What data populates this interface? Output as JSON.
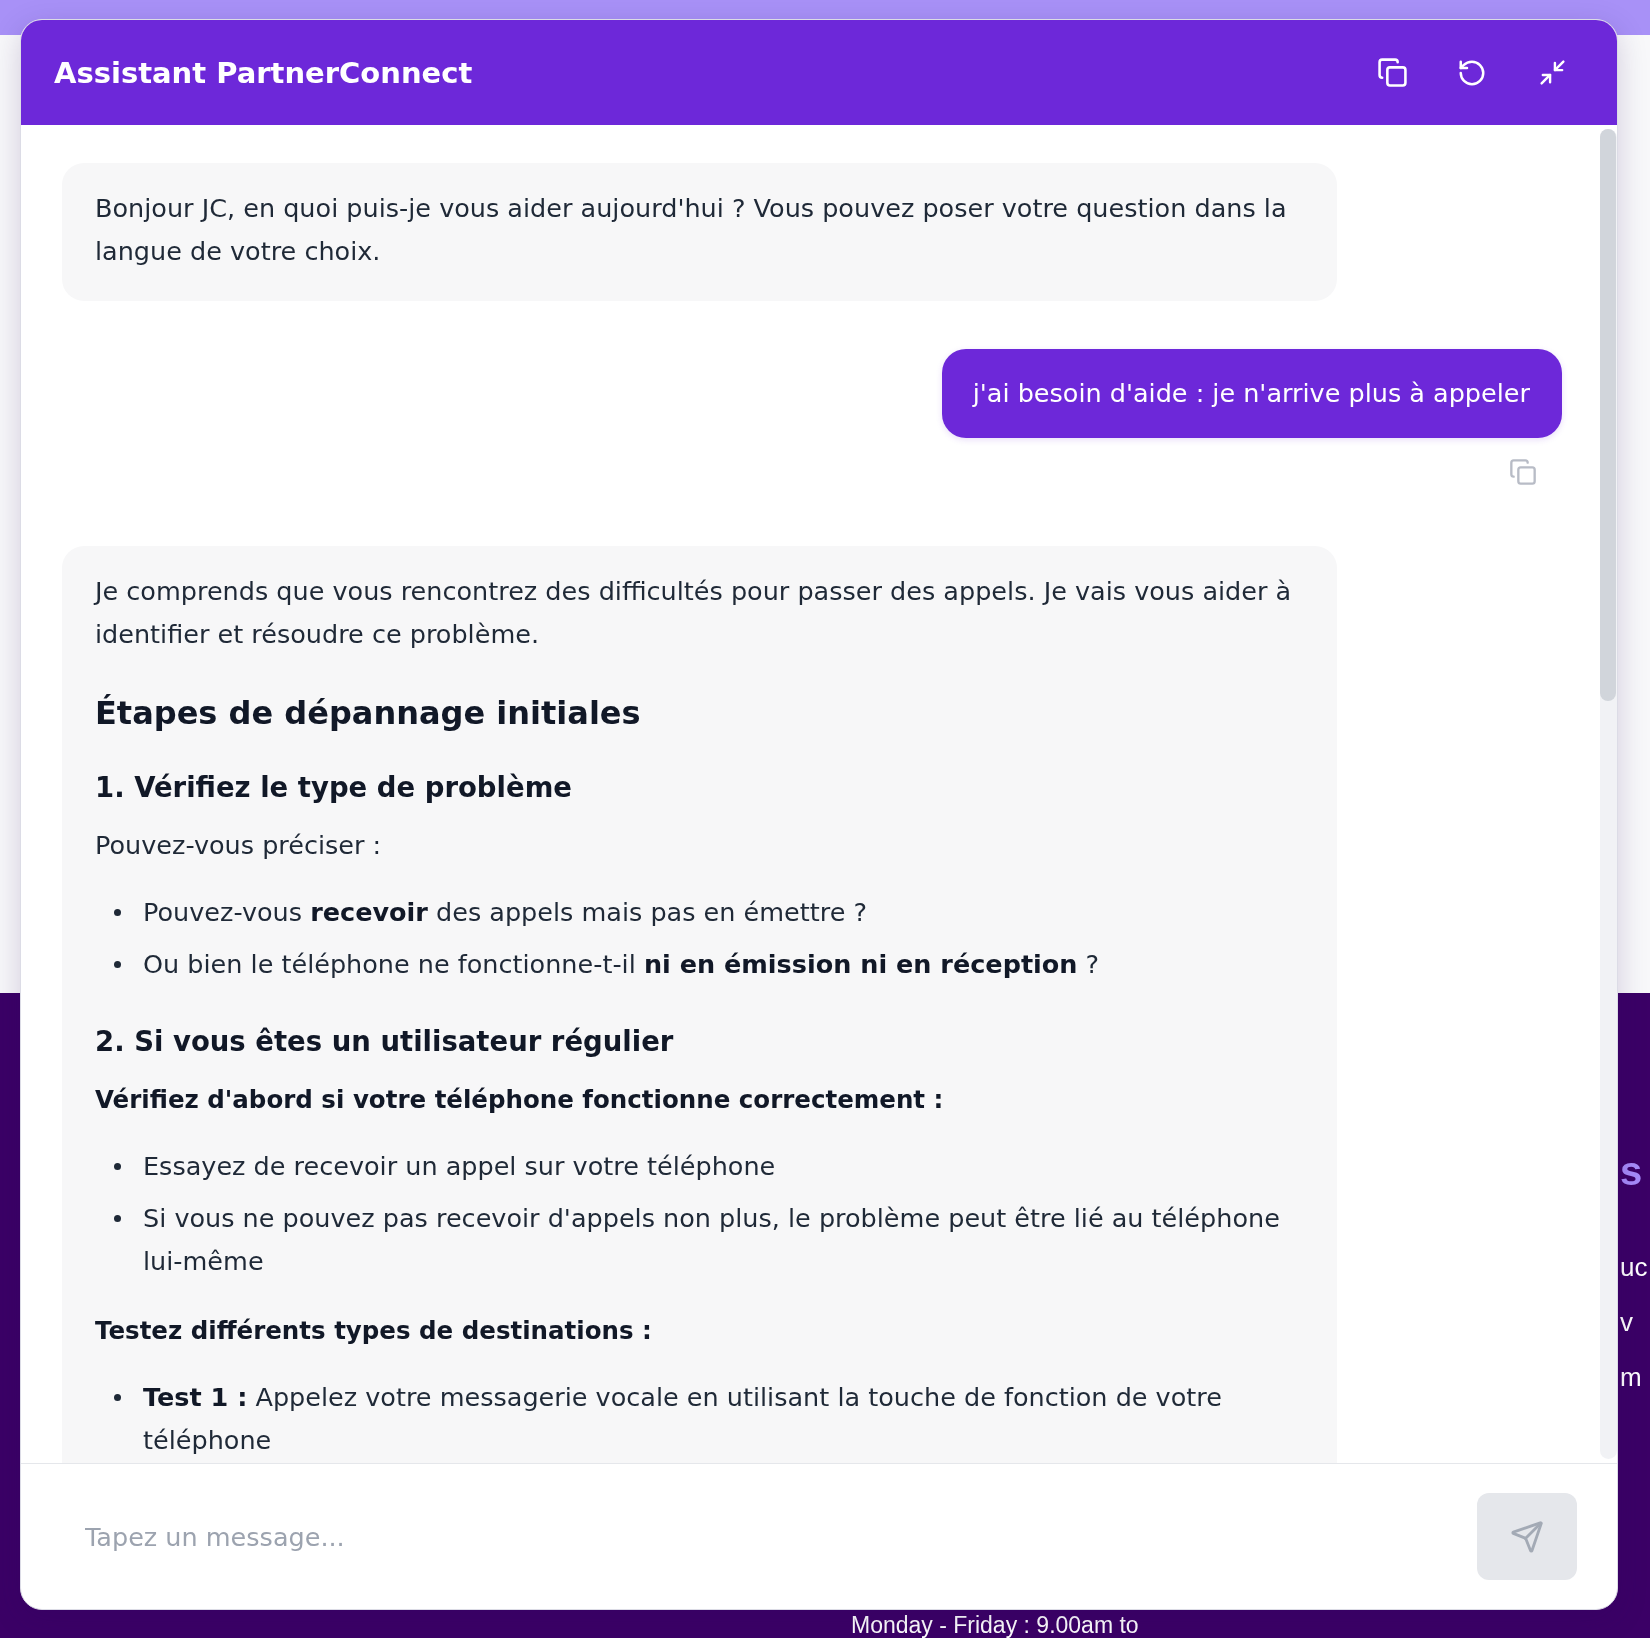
{
  "chat": {
    "title": "Assistant PartnerConnect",
    "messages": [
      {
        "kind": "assistant",
        "blocks": [
          {
            "kind": "paragraph",
            "text": "Bonjour JC, en quoi puis-je vous aider aujourd'hui ? Vous pouvez poser votre question dans la langue de votre choix."
          }
        ]
      },
      {
        "kind": "user",
        "text": "j'ai besoin d'aide : je n'arrive plus à appeler"
      },
      {
        "kind": "assistant",
        "blocks": [
          {
            "kind": "paragraph",
            "text": "Je comprends que vous rencontrez des difficultés pour passer des appels. Je vais vous aider à identifier et résoudre ce problème."
          },
          {
            "kind": "heading",
            "text": "Étapes de dépannage initiales"
          },
          {
            "kind": "subheading",
            "text": "1. Vérifiez le type de problème"
          },
          {
            "kind": "paragraph",
            "text": "Pouvez-vous préciser :"
          },
          {
            "kind": "list",
            "items": [
              "Pouvez-vous **recevoir** des appels mais pas en émettre ?",
              "Ou bien le téléphone ne fonctionne-t-il **ni en émission ni en réception** ?"
            ]
          },
          {
            "kind": "subheading",
            "text": "2. Si vous êtes un utilisateur régulier"
          },
          {
            "kind": "label",
            "text": "Vérifiez d'abord si votre téléphone fonctionne correctement :"
          },
          {
            "kind": "list",
            "items": [
              "Essayez de recevoir un appel sur votre téléphone",
              "Si vous ne pouvez pas recevoir d'appels non plus, le problème peut être lié au téléphone lui-même"
            ]
          },
          {
            "kind": "label",
            "text": "Testez différents types de destinations :"
          },
          {
            "kind": "list",
            "items": [
              "**Test 1 :** Appelez votre messagerie vocale en utilisant la touche de fonction de votre téléphone"
            ]
          }
        ]
      }
    ],
    "composer": {
      "placeholder": "Tapez un message...",
      "send_button": {
        "disabled": true
      }
    }
  },
  "background": {
    "heading_fragment": "s",
    "text_fragments": [
      "uc",
      "v",
      "m"
    ],
    "hours": "Monday - Friday : 9.00am to"
  }
}
